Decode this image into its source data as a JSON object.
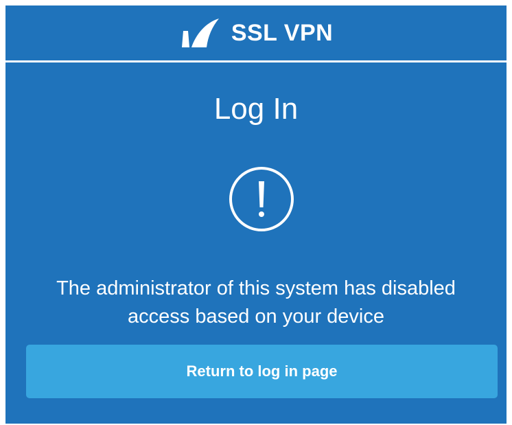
{
  "header": {
    "brand": "SSL VPN",
    "logo_icon": "shark-fin-logo-icon"
  },
  "page": {
    "title": "Log In",
    "alert_icon": "exclamation-circle-icon",
    "message_line1": "The administrator of this system has disabled",
    "message_line2": "access based on your device"
  },
  "actions": {
    "return_label": "Return to log in page"
  },
  "colors": {
    "panel_background": "#1f73bb",
    "button_background": "#38a6df",
    "text": "#ffffff"
  }
}
